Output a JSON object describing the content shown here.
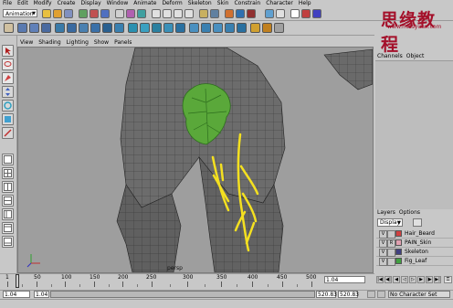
{
  "menubar": {
    "items": [
      "File",
      "Edit",
      "Modify",
      "Create",
      "Display",
      "Window",
      "Animate",
      "Deform",
      "Skeleton",
      "Skin",
      "Constrain",
      "Character",
      "Help"
    ]
  },
  "statusline": {
    "mode_selector": "Animation"
  },
  "panel": {
    "menus": [
      "View",
      "Shading",
      "Lighting",
      "Show",
      "Panels"
    ],
    "camera_label": "persp"
  },
  "channelbox": {
    "tabs": [
      "Channels",
      "Object"
    ]
  },
  "layers": {
    "tabs": [
      "Layers",
      "Options"
    ],
    "display_selector": "Display",
    "rows": [
      {
        "visible": "V",
        "ref": "",
        "name": "Hair_Beard",
        "color": "#d04040"
      },
      {
        "visible": "V",
        "ref": "R",
        "name": "PAIN_Skin",
        "color": "#e0a0b0"
      },
      {
        "visible": "V",
        "ref": "",
        "name": "Skeleton",
        "color": "#404080"
      },
      {
        "visible": "V",
        "ref": "",
        "name": "Fig_Leaf",
        "color": "#40a040"
      }
    ]
  },
  "timeslider": {
    "tick_labels": [
      "1",
      "50",
      "100",
      "150",
      "200",
      "250",
      "300",
      "350",
      "400",
      "450",
      "500"
    ],
    "current_frame": "1.04"
  },
  "rangeslider": {
    "start_time": "1.04",
    "playback_start": "1.04",
    "playback_end": "520.83",
    "end_time": "520.83",
    "character_set": "No Character Set"
  },
  "watermark": {
    "title": "思缘教程",
    "url": "www.missyuan.com"
  },
  "colors": {
    "background": "#c8c8c8",
    "viewport": "#9e9e9e",
    "accent_yellow": "#f4e020",
    "leaf_green": "#5aa83a"
  }
}
